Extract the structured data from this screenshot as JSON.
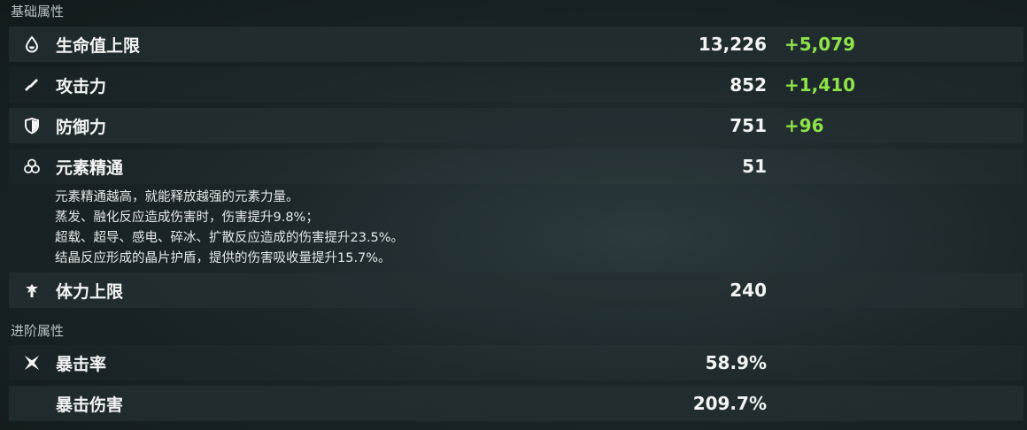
{
  "sections": {
    "basic": "基础属性",
    "advanced": "进阶属性"
  },
  "stats": [
    {
      "icon": "hp-droplet-icon",
      "label": "生命值上限",
      "value": "13,226",
      "bonus": "+5,079"
    },
    {
      "icon": "attack-sword-icon",
      "label": "攻击力",
      "value": "852",
      "bonus": "+1,410"
    },
    {
      "icon": "defense-shield-icon",
      "label": "防御力",
      "value": "751",
      "bonus": "+96"
    },
    {
      "icon": "elemental-mastery-icon",
      "label": "元素精通",
      "value": "51",
      "bonus": ""
    },
    {
      "icon": "stamina-icon",
      "label": "体力上限",
      "value": "240",
      "bonus": ""
    }
  ],
  "mastery_desc": [
    "元素精通越高，就能释放越强的元素力量。",
    "蒸发、融化反应造成伤害时，伤害提升9.8%；",
    "超载、超导、感电、碎冰、扩散反应造成的伤害提升23.5%。",
    "结晶反应形成的晶片护盾，提供的伤害吸收量提升15.7%。"
  ],
  "advanced_stats": [
    {
      "icon": "crit-rate-icon",
      "label": "暴击率",
      "value": "58.9%"
    },
    {
      "icon": "",
      "label": "暴击伤害",
      "value": "209.7%"
    }
  ],
  "colors": {
    "bonus_green": "#8fe24a",
    "row_dark": "#243032",
    "text": "#f4f4f4"
  }
}
